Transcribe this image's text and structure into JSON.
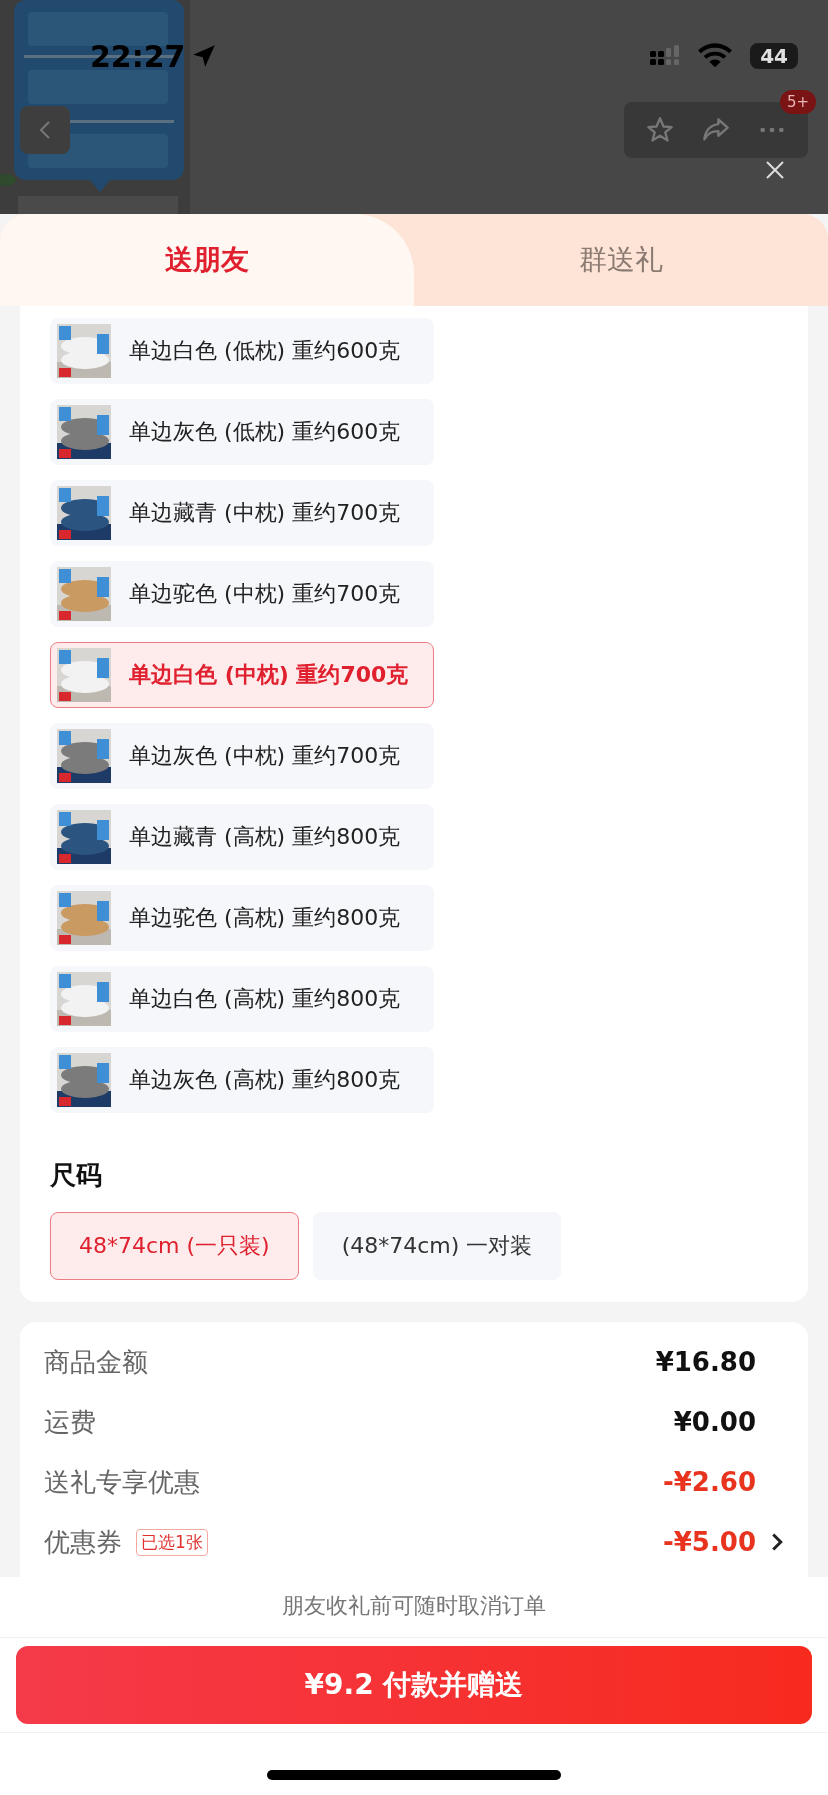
{
  "status_bar": {
    "time": "22:27",
    "battery": "44"
  },
  "header": {
    "badge": "5+"
  },
  "tabs": [
    {
      "label": "送朋友",
      "selected": true
    },
    {
      "label": "群送礼",
      "selected": false
    }
  ],
  "options": [
    {
      "label": "单边白色 (低枕) 重约600克",
      "selected": false,
      "color": "#f2f2f2"
    },
    {
      "label": "单边灰色 (低枕) 重约600克",
      "selected": false,
      "color": "#7b7b7b"
    },
    {
      "label": "单边藏青 (中枕) 重约700克",
      "selected": false,
      "color": "#2b5580"
    },
    {
      "label": "单边驼色 (中枕) 重约700克",
      "selected": false,
      "color": "#c99a62"
    },
    {
      "label": "单边白色 (中枕) 重约700克",
      "selected": true,
      "color": "#f2f2f2"
    },
    {
      "label": "单边灰色 (中枕) 重约700克",
      "selected": false,
      "color": "#7b7b7b"
    },
    {
      "label": "单边藏青 (高枕) 重约800克",
      "selected": false,
      "color": "#2b5580"
    },
    {
      "label": "单边驼色 (高枕) 重约800克",
      "selected": false,
      "color": "#c99a62"
    },
    {
      "label": "单边白色 (高枕) 重约800克",
      "selected": false,
      "color": "#f2f2f2"
    },
    {
      "label": "单边灰色 (高枕) 重约800克",
      "selected": false,
      "color": "#7b7b7b"
    }
  ],
  "size": {
    "title": "尺码",
    "options": [
      {
        "label": "48*74cm (一只装)",
        "selected": true
      },
      {
        "label": "(48*74cm) 一对装",
        "selected": false
      }
    ]
  },
  "summary": [
    {
      "kind": "plain",
      "label": "商品金额",
      "value": "¥16.80"
    },
    {
      "kind": "plain",
      "label": "运费",
      "value": "¥0.00"
    },
    {
      "kind": "discount",
      "label": "送礼专享优惠",
      "value": "-¥2.60"
    },
    {
      "kind": "coupon",
      "label": "优惠券",
      "tag": "已选1张",
      "value": "-¥5.00"
    }
  ],
  "notice": "朋友收礼前可随时取消订单",
  "pay_button": "¥9.2 付款并赠送"
}
